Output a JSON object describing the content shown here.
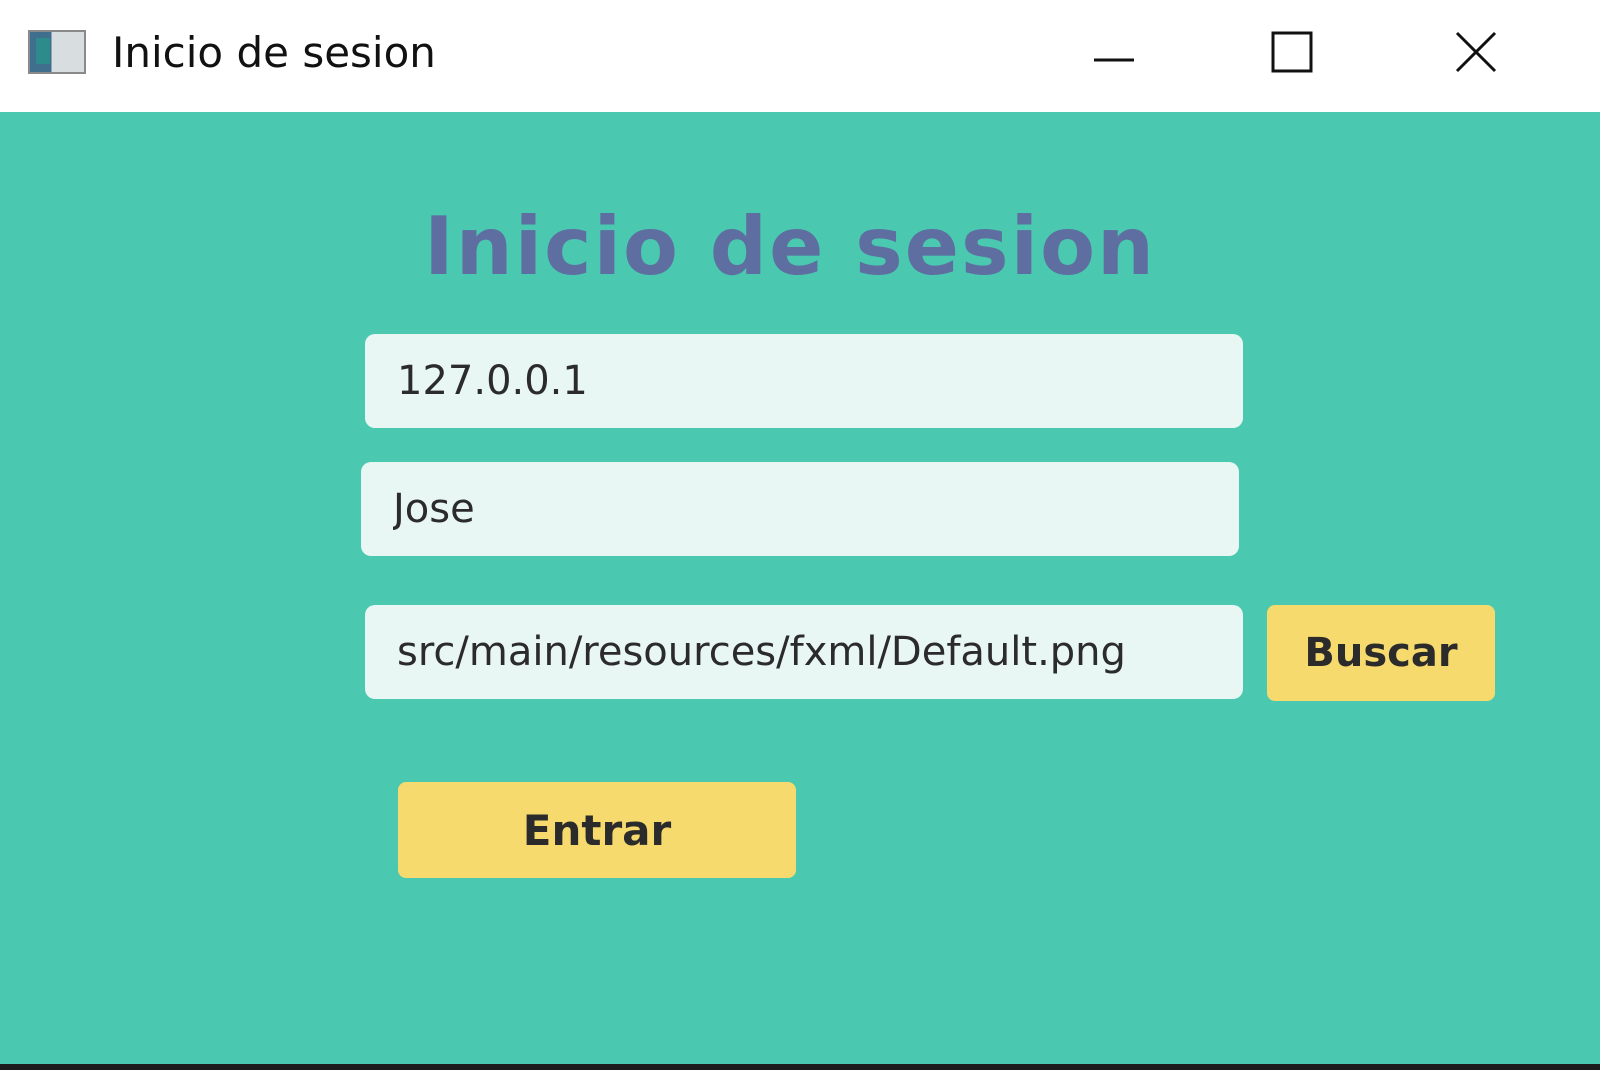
{
  "window": {
    "title": "Inicio de sesion",
    "icons": {
      "app": "app-window-icon",
      "minimize": "minimize-icon",
      "maximize": "maximize-icon",
      "close": "close-icon"
    }
  },
  "form": {
    "heading": "Inicio de sesion",
    "host_value": "127.0.0.1",
    "user_value": "Jose",
    "image_path_value": "src/main/resources/fxml/Default.png",
    "browse_label": "Buscar",
    "submit_label": "Entrar"
  },
  "colors": {
    "background": "#4ac8b0",
    "heading": "#5e6ea0",
    "field_bg": "#e8f7f3",
    "button_bg": "#f6da6e"
  }
}
